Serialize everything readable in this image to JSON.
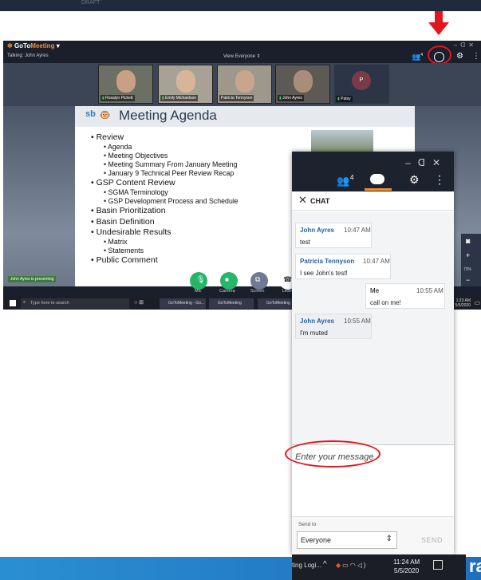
{
  "ghost_text": "DRAFT",
  "arrow_color": "#e3161d",
  "gtm": {
    "logo_prefix": "GoTo",
    "logo_suffix": "Meeting",
    "talking": "Talking: John Ayres",
    "view": "View Everyone",
    "people_count": "4",
    "presenting": "John Ayres is presenting",
    "attendees": [
      "Rosalyn Pickett",
      "Emily Michaelson",
      "Patricia Tennyson",
      "John Ayres",
      "Patsy"
    ],
    "attendee_initial": "P",
    "zoom": "70%",
    "controls": [
      "Mic",
      "Camera",
      "Screen",
      "Leave"
    ],
    "taskbar": {
      "search_placeholder": "Type here to search",
      "apps": [
        "GoToMeeting - Go...",
        "GoToMeeting",
        "GoToMeeting"
      ],
      "time": "1:23 AM",
      "date": "5/5/2020"
    }
  },
  "slide": {
    "title": "Meeting Agenda",
    "logo": "sb",
    "bullets": [
      {
        "text": "Review",
        "level": 1
      },
      {
        "text": "Agenda",
        "level": 2
      },
      {
        "text": "Meeting Objectives",
        "level": 2
      },
      {
        "text": "Meeting Summary From January Meeting",
        "level": 2
      },
      {
        "text": "January 9 Technical Peer Review Recap",
        "level": 2
      },
      {
        "text": "GSP Content Review",
        "level": 1
      },
      {
        "text": "SGMA Terminology",
        "level": 2
      },
      {
        "text": "GSP Development Process and Schedule",
        "level": 2
      },
      {
        "text": "Basin Prioritization",
        "level": 1
      },
      {
        "text": "Basin Definition",
        "level": 1
      },
      {
        "text": "Undesirable Results",
        "level": 1
      },
      {
        "text": "Matrix",
        "level": 2
      },
      {
        "text": "Statements",
        "level": 2
      },
      {
        "text": "Public Comment",
        "level": 1
      }
    ]
  },
  "chat": {
    "people_count": "4",
    "title": "CHAT",
    "messages": [
      {
        "sender": "John Ayres",
        "time": "10:47 AM",
        "text": "test"
      },
      {
        "sender": "Patricia Tennyson",
        "time": "10:47 AM",
        "text": "I see John's test!"
      },
      {
        "sender": "Me",
        "time": "10:55 AM",
        "text": "call on me!"
      },
      {
        "sender": "John Ayres",
        "time": "10:55 AM",
        "text": "I'm muted"
      }
    ],
    "input_placeholder": "Enter your message",
    "send_to_label": "Send to",
    "send_to_value": "Everyone",
    "send_label": "SEND"
  },
  "bottom": {
    "app_fragment": "ting Logi...",
    "time": "11:24 AM",
    "date": "5/5/2020",
    "draft_fragment": "raf"
  },
  "colors": {
    "accent_orange": "#f68d2e",
    "link_blue": "#2661a6",
    "highlight_red": "#e3161d",
    "chat_dark": "#1d232e"
  }
}
